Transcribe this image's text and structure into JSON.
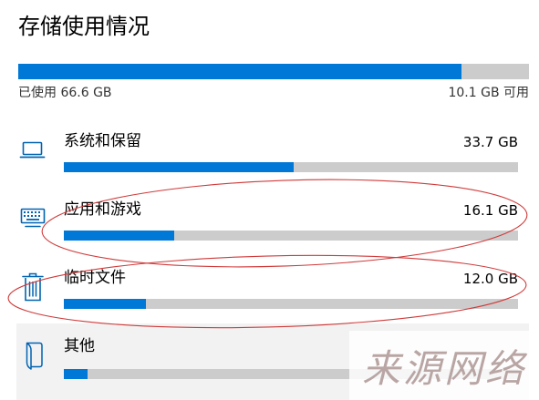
{
  "title": "存储使用情况",
  "overall": {
    "used_label": "已使用 66.6 GB",
    "free_label": "10.1 GB 可用",
    "used_fraction": 0.868
  },
  "categories": [
    {
      "icon": "laptop-icon",
      "label": "系统和保留",
      "size": "33.7 GB",
      "fill_fraction": 0.506
    },
    {
      "icon": "keyboard-icon",
      "label": "应用和游戏",
      "size": "16.1 GB",
      "fill_fraction": 0.242
    },
    {
      "icon": "trash-icon",
      "label": "临时文件",
      "size": "12.0 GB",
      "fill_fraction": 0.18
    },
    {
      "icon": "document-icon",
      "label": "其他",
      "fill_fraction": 0.052
    }
  ],
  "colors": {
    "accent": "#0078d7",
    "track": "#cccccc",
    "icon": "#0063b1",
    "annotation": "#d03a3a"
  },
  "watermark": "来源网络"
}
